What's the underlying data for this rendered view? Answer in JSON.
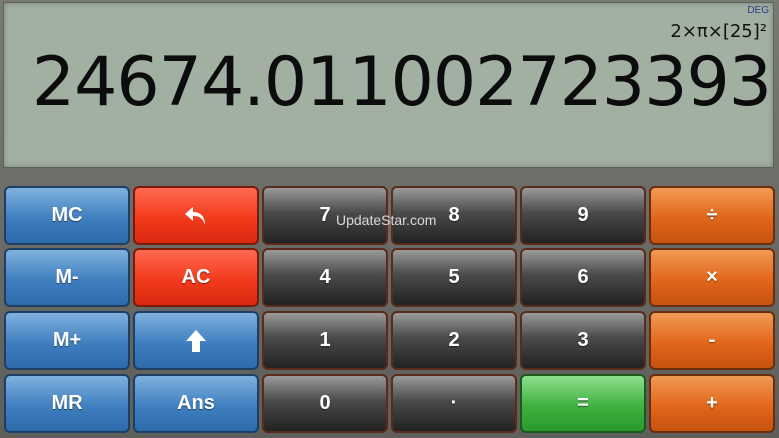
{
  "display": {
    "mode": "DEG",
    "expression": "2×π×[25]²",
    "result": "24674.011002723393"
  },
  "keys": {
    "mc": "MC",
    "m_minus": "M-",
    "m_plus": "M+",
    "mr": "MR",
    "back_icon": "undo-arrow-icon",
    "ac": "AC",
    "shift_icon": "up-arrow-icon",
    "ans": "Ans",
    "seven": "7",
    "eight": "8",
    "nine": "9",
    "four": "4",
    "five": "5",
    "six": "6",
    "one": "1",
    "two": "2",
    "three": "3",
    "zero": "0",
    "dot": "·",
    "equals": "=",
    "divide": "÷",
    "multiply": "×",
    "minus": "-",
    "plus": "+"
  },
  "watermark": "UpdateStar.com",
  "colors": {
    "display_bg": "#a2b0a2",
    "blue": "#3f7fbf",
    "red": "#f23a1c",
    "dark": "#3a3a3a",
    "orange": "#e0661a",
    "green": "#3fb13f"
  }
}
